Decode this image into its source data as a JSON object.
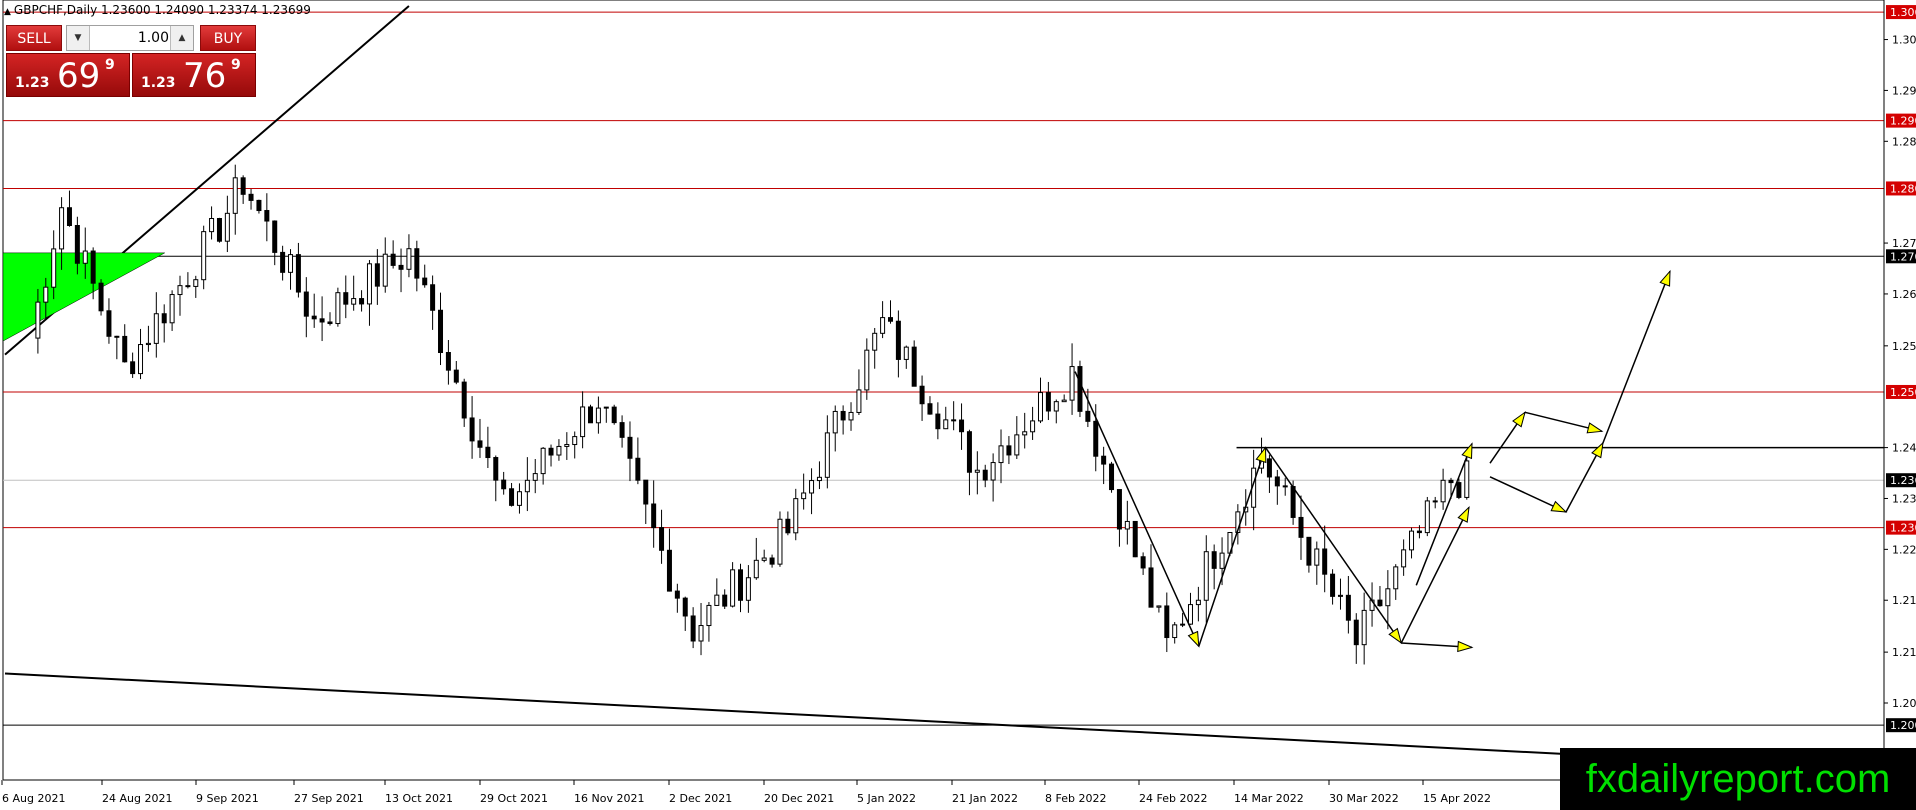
{
  "header": {
    "title": "GBPCHF,Daily  1.23600 1.24090 1.23374 1.23699"
  },
  "trade_panel": {
    "sell_label": "SELL",
    "buy_label": "BUY",
    "lot_value": "1.00",
    "sell_quote": {
      "big": "1.23",
      "pips": "69",
      "fraction": "9"
    },
    "buy_quote": {
      "big": "1.23",
      "pips": "76",
      "fraction": "9"
    }
  },
  "brand": {
    "text": "fxdailyreport.com"
  },
  "colors": {
    "bull_candle": "#ffffff",
    "bear_candle": "#000000",
    "horizontal_level_red": "#c00000",
    "horizontal_level_black": "#000000",
    "triangle_fill": "#00ff00",
    "arrow_fill": "#ffff00",
    "brand_text": "#00e000"
  },
  "chart_data": {
    "type": "candlestick",
    "symbol": "GBPCHF",
    "timeframe": "Daily",
    "ylim": [
      1.1928,
      1.3066
    ],
    "y_ticks": [
      "1.30195",
      "1.29445",
      "1.28695",
      "1.27195",
      "1.26445",
      "1.25680",
      "1.24180",
      "1.23430",
      "1.22680",
      "1.21930",
      "1.21165",
      "1.20415",
      "1.19665"
    ],
    "x_ticks": [
      "6 Aug 2021",
      "24 Aug 2021",
      "9 Sep 2021",
      "27 Sep 2021",
      "13 Oct 2021",
      "29 Oct 2021",
      "16 Nov 2021",
      "2 Dec 2021",
      "20 Dec 2021",
      "5 Jan 2022",
      "21 Jan 2022",
      "8 Feb 2022",
      "24 Feb 2022",
      "14 Mar 2022",
      "30 Mar 2022",
      "15 Apr 2022"
    ],
    "price_levels": [
      {
        "value": 1.306,
        "label": "1.30600",
        "color": "red"
      },
      {
        "value": 1.29,
        "label": "1.29000",
        "color": "red"
      },
      {
        "value": 1.28,
        "label": "1.28000",
        "color": "red"
      },
      {
        "value": 1.27,
        "label": "1.27000",
        "color": "black"
      },
      {
        "value": 1.25,
        "label": "1.25000",
        "color": "red"
      },
      {
        "value": 1.23,
        "label": "1.23000",
        "color": "red"
      },
      {
        "value": 1.20088,
        "label": "1.20088",
        "color": "black"
      }
    ],
    "current_price": {
      "value": 1.23699,
      "label": "1.23699"
    },
    "neckline": {
      "value": 1.2418,
      "from": "14 Mar 2022"
    },
    "ohlc_anchor_closes": [
      {
        "date": "6 Aug 2021",
        "close": 1.258
      },
      {
        "date": "11 Aug 2021",
        "close": 1.2775
      },
      {
        "date": "24 Aug 2021",
        "close": 1.2535
      },
      {
        "date": "9 Sep 2021",
        "close": 1.2745
      },
      {
        "date": "14 Sep 2021",
        "close": 1.281
      },
      {
        "date": "27 Sep 2021",
        "close": 1.2605
      },
      {
        "date": "13 Oct 2021",
        "close": 1.2705
      },
      {
        "date": "29 Oct 2021",
        "close": 1.233
      },
      {
        "date": "16 Nov 2021",
        "close": 1.249
      },
      {
        "date": "2 Dec 2021",
        "close": 1.215
      },
      {
        "date": "20 Dec 2021",
        "close": 1.2295
      },
      {
        "date": "5 Jan 2022",
        "close": 1.26
      },
      {
        "date": "21 Jan 2022",
        "close": 1.2385
      },
      {
        "date": "8 Feb 2022",
        "close": 1.253
      },
      {
        "date": "24 Feb 2022",
        "close": 1.2125
      },
      {
        "date": "14 Mar 2022",
        "close": 1.2405
      },
      {
        "date": "30 Mar 2022",
        "close": 1.213
      },
      {
        "date": "15 Apr 2022",
        "close": 1.237
      }
    ],
    "annotations": {
      "triangle": {
        "shape": "green wedge",
        "from": "6 Aug 2021",
        "to": "27 Aug 2021"
      },
      "trend_lines": [
        {
          "from_date": "6 Aug 2021",
          "from_price": 1.2555,
          "to_date": "13 Oct 2021",
          "to_price": 1.3069
        },
        {
          "from_date": "6 Aug 2021",
          "from_price": 1.2085,
          "to_date": "end",
          "to_price": 1.1942
        }
      ],
      "pattern": "double bottom with projected up / down scenarios"
    }
  }
}
